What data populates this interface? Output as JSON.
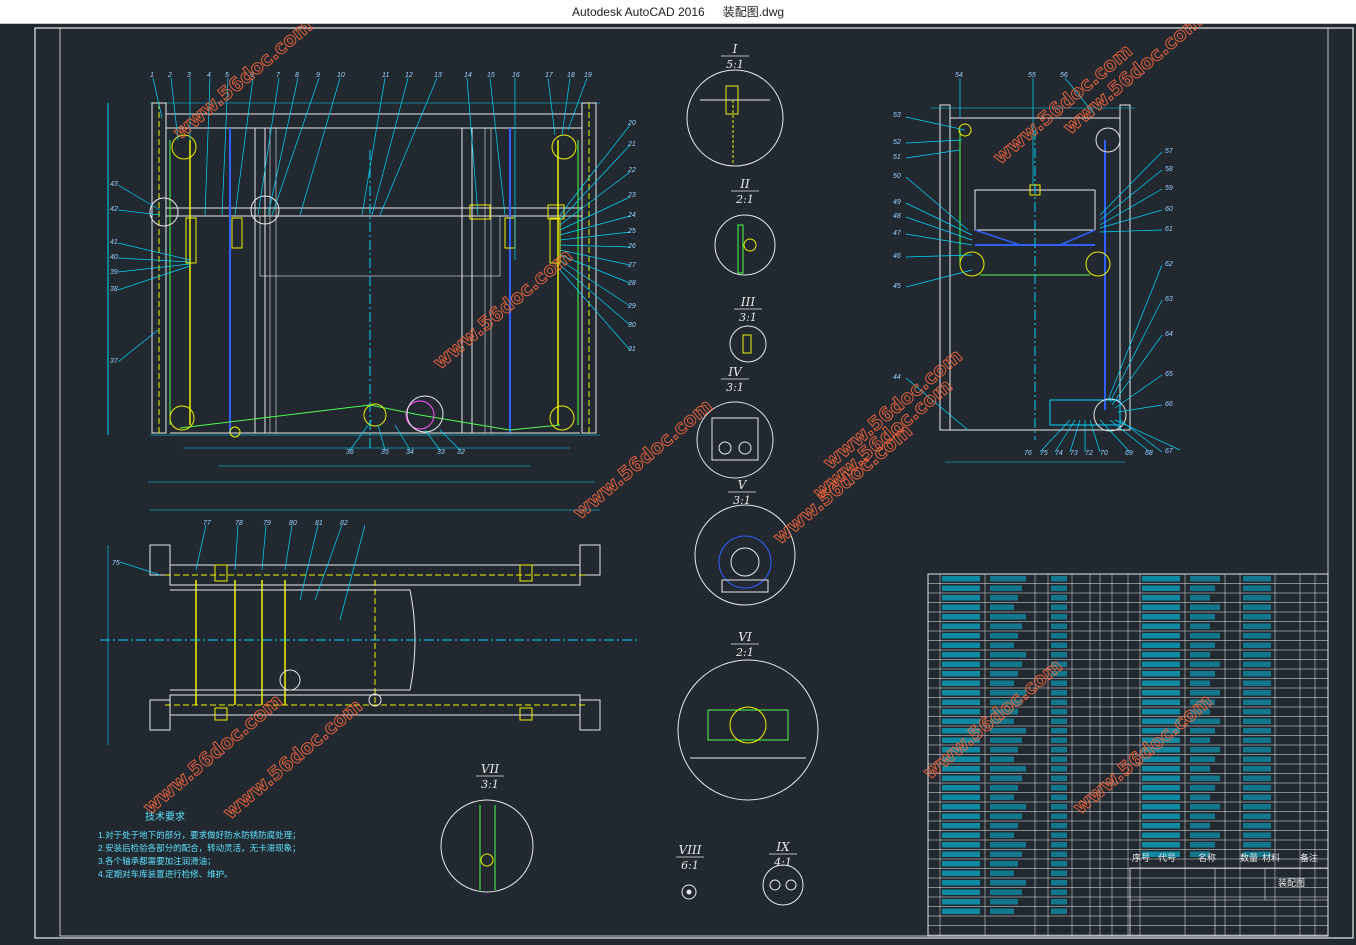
{
  "window": {
    "app_name": "Autodesk AutoCAD 2016",
    "file_name": "装配图.dwg"
  },
  "drawing": {
    "detail_views": [
      {
        "id": "I",
        "scale": "5:1"
      },
      {
        "id": "II",
        "scale": "2:1"
      },
      {
        "id": "III",
        "scale": "3:1"
      },
      {
        "id": "IV",
        "scale": "3:1"
      },
      {
        "id": "V",
        "scale": "3:1"
      },
      {
        "id": "VI",
        "scale": "2:1"
      },
      {
        "id": "VII",
        "scale": "3:1"
      },
      {
        "id": "VIII",
        "scale": "6:1"
      },
      {
        "id": "IX",
        "scale": "4:1"
      }
    ],
    "front_view_top_labels": [
      "1",
      "2",
      "3",
      "4",
      "5",
      "6",
      "7",
      "8",
      "9",
      "10",
      "11",
      "12",
      "13",
      "14",
      "15",
      "16",
      "17",
      "18",
      "19"
    ],
    "front_view_right_labels": [
      "20",
      "21",
      "22",
      "23",
      "24",
      "25",
      "26",
      "27",
      "28",
      "29",
      "30",
      "31"
    ],
    "front_view_left_labels": [
      "43",
      "42",
      "41",
      "40",
      "39",
      "38",
      "37"
    ],
    "front_view_bottom_labels": [
      "36",
      "35",
      "34",
      "33",
      "32"
    ],
    "side_view_top_labels": [
      "54",
      "55",
      "56"
    ],
    "side_view_left_labels": [
      "53",
      "52",
      "51",
      "50",
      "49",
      "48",
      "47",
      "46",
      "45",
      "44"
    ],
    "side_view_right_labels": [
      "57",
      "58",
      "59",
      "60",
      "61",
      "62",
      "63",
      "64",
      "65",
      "66",
      "67"
    ],
    "side_view_bottom_labels": [
      "76",
      "75",
      "74",
      "73",
      "72",
      "70",
      "69",
      "68"
    ],
    "plan_view_labels": [
      "75",
      "77",
      "78",
      "79",
      "80",
      "81",
      "82"
    ],
    "technical_requirements": {
      "title": "技术要求",
      "items": [
        "1.对于处于地下的部分，要求做好防水防锈防腐处理；",
        "2.安装后检验各部分的配合，转动灵活，无卡滞现象；",
        "3.各个轴承都需要加注润滑油；",
        "4.定期对车库装置进行检修、维护。"
      ]
    },
    "bom_header": {
      "seq": "序号",
      "code": "代号",
      "name": "名称",
      "qty": "数量",
      "material": "材料",
      "remark": "备注"
    },
    "title_block": {
      "drawing_name": "装配图"
    },
    "watermark": "www.56doc.com"
  },
  "colors": {
    "background": "#212830",
    "frame": "#e8e8e8",
    "cyan": "#00d8ff",
    "yellow": "#f0f000",
    "green": "#4cff4c",
    "blue": "#3060ff",
    "red": "#ff4040",
    "magenta": "#ff50ff",
    "watermark": "#ff6a3c"
  }
}
